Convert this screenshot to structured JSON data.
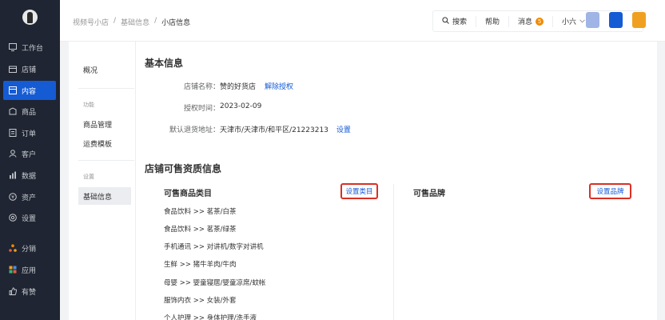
{
  "sidebar": {
    "items": [
      {
        "label": "工作台",
        "icon": "dashboard-icon"
      },
      {
        "label": "店铺",
        "icon": "store-icon"
      },
      {
        "label": "内容",
        "icon": "content-icon",
        "active": true
      },
      {
        "label": "商品",
        "icon": "product-icon"
      },
      {
        "label": "订单",
        "icon": "order-icon"
      },
      {
        "label": "客户",
        "icon": "customer-icon"
      },
      {
        "label": "数据",
        "icon": "data-icon"
      },
      {
        "label": "资产",
        "icon": "asset-icon"
      },
      {
        "label": "设置",
        "icon": "settings-icon"
      },
      {
        "label": "分销",
        "icon": "distribution-icon"
      },
      {
        "label": "应用",
        "icon": "apps-icon"
      },
      {
        "label": "有赞",
        "icon": "youzan-icon"
      }
    ]
  },
  "header": {
    "breadcrumb": [
      "视频号小店",
      "基础信息",
      "小店信息"
    ],
    "separator": "/",
    "search_label": "搜索",
    "help_label": "帮助",
    "messages_label": "消息",
    "messages_count": "5",
    "user_label": "小六",
    "app_icons": [
      {
        "label": "",
        "color": "#a0b4e6"
      },
      {
        "label": "",
        "color": "#155bd4"
      },
      {
        "label": "",
        "color": "#f0a020"
      }
    ]
  },
  "subnav": {
    "overview": "概况",
    "group_function": "功能",
    "product_management": "商品管理",
    "shipping_template": "运费模板",
    "group_settings": "设置",
    "basic_info": "基础信息"
  },
  "basic_info": {
    "title": "基本信息",
    "store_name_label": "店铺名称：",
    "store_name_value": "赞的好货店",
    "unbind_link": "解除授权",
    "auth_time_label": "授权时间：",
    "auth_time_value": "2023-02-09",
    "return_address_label": "默认退货地址：",
    "return_address_value": "天津市/天津市/和平区/21223213",
    "set_link": "设置"
  },
  "qualification": {
    "title": "店铺可售资质信息",
    "categories_title": "可售商品类目",
    "set_categories": "设置类目",
    "brands_title": "可售品牌",
    "set_brands": "设置品牌",
    "categories": [
      "食品饮料 >> 茗茶/白茶",
      "食品饮料 >> 茗茶/绿茶",
      "手机通讯 >> 对讲机/数字对讲机",
      "生鲜 >> 猪牛羊肉/牛肉",
      "母婴 >> 婴童寝居/婴童凉席/蚊帐",
      "服饰内衣 >> 女装/外套",
      "个人护理 >> 身体护理/洗手液"
    ]
  },
  "colors": {
    "sidebar_bg": "#1f2532",
    "accent": "#155bd4",
    "highlight_border": "#d93025"
  }
}
